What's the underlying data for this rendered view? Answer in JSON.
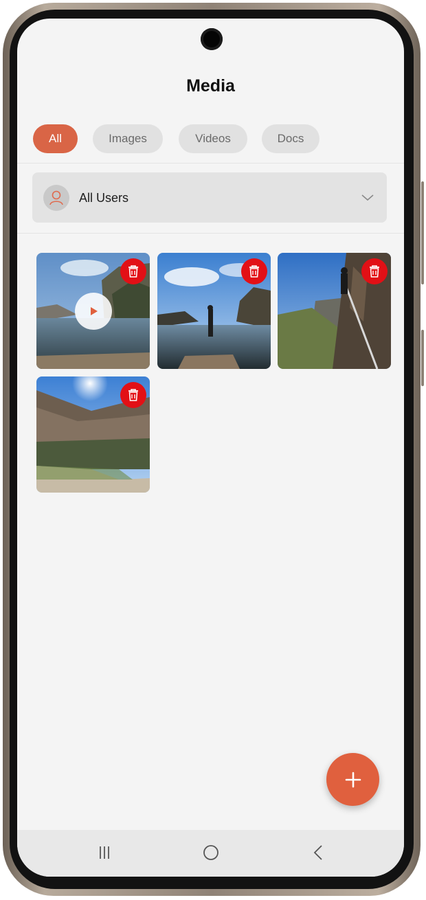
{
  "header": {
    "title": "Media"
  },
  "filter_tabs": [
    {
      "label": "All",
      "active": true
    },
    {
      "label": "Images",
      "active": false
    },
    {
      "label": "Videos",
      "active": false
    },
    {
      "label": "Docs",
      "active": false
    }
  ],
  "user_filter": {
    "selected": "All Users",
    "icon": "person-icon"
  },
  "media_items": [
    {
      "type": "video",
      "scene": "rock pool with play overlay",
      "delete_icon": "trash-icon"
    },
    {
      "type": "image",
      "scene": "person standing by pool",
      "delete_icon": "trash-icon"
    },
    {
      "type": "image",
      "scene": "hiker on cliff",
      "delete_icon": "trash-icon"
    },
    {
      "type": "image",
      "scene": "canyon with sun",
      "delete_icon": "trash-icon"
    }
  ],
  "fab": {
    "icon": "plus-icon"
  },
  "system_nav": {
    "recents_icon": "recents-icon",
    "home_icon": "home-icon",
    "back_icon": "back-icon"
  },
  "colors": {
    "accent": "#d96546",
    "delete": "#e21016",
    "background": "#f4f4f4",
    "chip": "#e1e1e1"
  }
}
